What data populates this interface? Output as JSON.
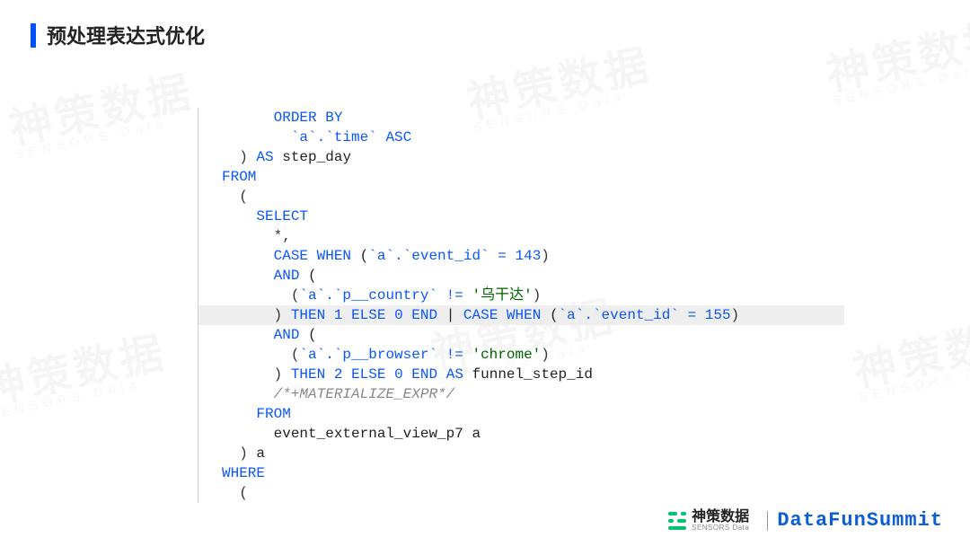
{
  "title": "预处理表达式优化",
  "watermark": {
    "cn": "神策数据",
    "en": "SENSORS Data"
  },
  "code": {
    "lines": [
      {
        "indent": 3,
        "tokens": [
          {
            "t": "kw",
            "v": "ORDER BY"
          }
        ]
      },
      {
        "indent": 4,
        "tokens": [
          {
            "t": "bt",
            "v": "`a`.`time`"
          },
          {
            "t": "plain",
            "v": " "
          },
          {
            "t": "kw",
            "v": "ASC"
          }
        ]
      },
      {
        "indent": 1,
        "tokens": [
          {
            "t": "punc",
            "v": ")"
          },
          {
            "t": "plain",
            "v": " "
          },
          {
            "t": "kw",
            "v": "AS"
          },
          {
            "t": "plain",
            "v": " step_day"
          }
        ]
      },
      {
        "indent": 0,
        "tokens": [
          {
            "t": "kw",
            "v": "FROM"
          }
        ]
      },
      {
        "indent": 1,
        "tokens": [
          {
            "t": "punc",
            "v": "("
          }
        ]
      },
      {
        "indent": 2,
        "tokens": [
          {
            "t": "kw",
            "v": "SELECT"
          }
        ]
      },
      {
        "indent": 3,
        "tokens": [
          {
            "t": "punc",
            "v": "*,"
          }
        ]
      },
      {
        "indent": 3,
        "tokens": [
          {
            "t": "kw",
            "v": "CASE WHEN"
          },
          {
            "t": "plain",
            "v": " ("
          },
          {
            "t": "bt",
            "v": "`a`.`event_id`"
          },
          {
            "t": "plain",
            "v": " "
          },
          {
            "t": "op",
            "v": "="
          },
          {
            "t": "plain",
            "v": " "
          },
          {
            "t": "num",
            "v": "143"
          },
          {
            "t": "punc",
            "v": ")"
          }
        ]
      },
      {
        "indent": 3,
        "tokens": [
          {
            "t": "kw",
            "v": "AND"
          },
          {
            "t": "plain",
            "v": " ("
          }
        ]
      },
      {
        "indent": 4,
        "tokens": [
          {
            "t": "punc",
            "v": "("
          },
          {
            "t": "bt",
            "v": "`a`.`p__country`"
          },
          {
            "t": "plain",
            "v": " "
          },
          {
            "t": "op",
            "v": "!="
          },
          {
            "t": "plain",
            "v": " "
          },
          {
            "t": "str",
            "v": "'乌干达'"
          },
          {
            "t": "punc",
            "v": ")"
          }
        ]
      },
      {
        "indent": 3,
        "hl": true,
        "tokens": [
          {
            "t": "punc",
            "v": ")"
          },
          {
            "t": "plain",
            "v": " "
          },
          {
            "t": "kw",
            "v": "THEN"
          },
          {
            "t": "plain",
            "v": " "
          },
          {
            "t": "num",
            "v": "1"
          },
          {
            "t": "plain",
            "v": " "
          },
          {
            "t": "kw",
            "v": "ELSE"
          },
          {
            "t": "plain",
            "v": " "
          },
          {
            "t": "num",
            "v": "0"
          },
          {
            "t": "plain",
            "v": " "
          },
          {
            "t": "kw",
            "v": "END"
          },
          {
            "t": "plain",
            "v": " | "
          },
          {
            "t": "kw",
            "v": "CASE WHEN"
          },
          {
            "t": "plain",
            "v": " ("
          },
          {
            "t": "bt",
            "v": "`a`.`event_id`"
          },
          {
            "t": "plain",
            "v": " "
          },
          {
            "t": "op",
            "v": "="
          },
          {
            "t": "plain",
            "v": " "
          },
          {
            "t": "num",
            "v": "155"
          },
          {
            "t": "punc",
            "v": ")"
          }
        ]
      },
      {
        "indent": 3,
        "tokens": [
          {
            "t": "kw",
            "v": "AND"
          },
          {
            "t": "plain",
            "v": " ("
          }
        ]
      },
      {
        "indent": 4,
        "tokens": [
          {
            "t": "punc",
            "v": "("
          },
          {
            "t": "bt",
            "v": "`a`.`p__browser`"
          },
          {
            "t": "plain",
            "v": " "
          },
          {
            "t": "op",
            "v": "!="
          },
          {
            "t": "plain",
            "v": " "
          },
          {
            "t": "str",
            "v": "'chrome'"
          },
          {
            "t": "punc",
            "v": ")"
          }
        ]
      },
      {
        "indent": 3,
        "tokens": [
          {
            "t": "punc",
            "v": ")"
          },
          {
            "t": "plain",
            "v": " "
          },
          {
            "t": "kw",
            "v": "THEN"
          },
          {
            "t": "plain",
            "v": " "
          },
          {
            "t": "num",
            "v": "2"
          },
          {
            "t": "plain",
            "v": " "
          },
          {
            "t": "kw",
            "v": "ELSE"
          },
          {
            "t": "plain",
            "v": " "
          },
          {
            "t": "num",
            "v": "0"
          },
          {
            "t": "plain",
            "v": " "
          },
          {
            "t": "kw",
            "v": "END"
          },
          {
            "t": "plain",
            "v": " "
          },
          {
            "t": "kw",
            "v": "AS"
          },
          {
            "t": "plain",
            "v": " funnel_step_id"
          }
        ]
      },
      {
        "indent": 3,
        "tokens": [
          {
            "t": "cmt",
            "v": "/*+MATERIALIZE_EXPR*/"
          }
        ]
      },
      {
        "indent": 2,
        "tokens": [
          {
            "t": "kw",
            "v": "FROM"
          }
        ]
      },
      {
        "indent": 3,
        "tokens": [
          {
            "t": "plain",
            "v": "event_external_view_p7 a"
          }
        ]
      },
      {
        "indent": 1,
        "tokens": [
          {
            "t": "punc",
            "v": ")"
          },
          {
            "t": "plain",
            "v": " a"
          }
        ]
      },
      {
        "indent": 0,
        "tokens": [
          {
            "t": "kw",
            "v": "WHERE"
          }
        ]
      },
      {
        "indent": 1,
        "tokens": [
          {
            "t": "punc",
            "v": "("
          }
        ]
      }
    ]
  },
  "footer": {
    "sensors_cn": "神策数据",
    "sensors_en": "SENSORS Data",
    "datafun": "DataFunSummit"
  }
}
